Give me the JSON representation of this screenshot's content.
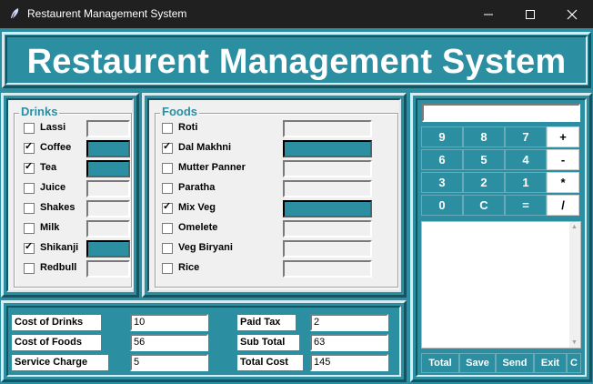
{
  "window": {
    "title": "Restaurent Management System"
  },
  "header": {
    "title": "Restaurent Management System"
  },
  "drinks": {
    "title": "Drinks",
    "items": [
      {
        "label": "Lassi",
        "checked": false
      },
      {
        "label": "Coffee",
        "checked": true
      },
      {
        "label": "Tea",
        "checked": true
      },
      {
        "label": "Juice",
        "checked": false
      },
      {
        "label": "Shakes",
        "checked": false
      },
      {
        "label": "Milk",
        "checked": false
      },
      {
        "label": "Shikanji",
        "checked": true
      },
      {
        "label": "Redbull",
        "checked": false
      }
    ]
  },
  "foods": {
    "title": "Foods",
    "items": [
      {
        "label": "Roti",
        "checked": false
      },
      {
        "label": "Dal Makhni",
        "checked": true
      },
      {
        "label": "Mutter Panner",
        "checked": false
      },
      {
        "label": "Paratha",
        "checked": false
      },
      {
        "label": "Mix Veg",
        "checked": true
      },
      {
        "label": "Omelete",
        "checked": false
      },
      {
        "label": "Veg Biryani",
        "checked": false
      },
      {
        "label": "Rice",
        "checked": false
      }
    ]
  },
  "costs": {
    "cost_of_drinks": {
      "label": "Cost of Drinks",
      "value": "10"
    },
    "cost_of_foods": {
      "label": "Cost of Foods",
      "value": "56"
    },
    "service_charge": {
      "label": "Service Charge",
      "value": "5"
    },
    "paid_tax": {
      "label": "Paid Tax",
      "value": "2"
    },
    "sub_total": {
      "label": "Sub Total",
      "value": "63"
    },
    "total_cost": {
      "label": "Total Cost",
      "value": "145"
    }
  },
  "calculator": {
    "display": "",
    "keys": [
      "9",
      "8",
      "7",
      "+",
      "6",
      "5",
      "4",
      "-",
      "3",
      "2",
      "1",
      "*",
      "0",
      "C",
      "=",
      "/"
    ]
  },
  "bottom_buttons": {
    "total": "Total",
    "save": "Save",
    "send": "Send",
    "exit": "Exit",
    "clear": "C"
  },
  "colors": {
    "accent": "#2b8ea1",
    "titlebar": "#202020"
  }
}
